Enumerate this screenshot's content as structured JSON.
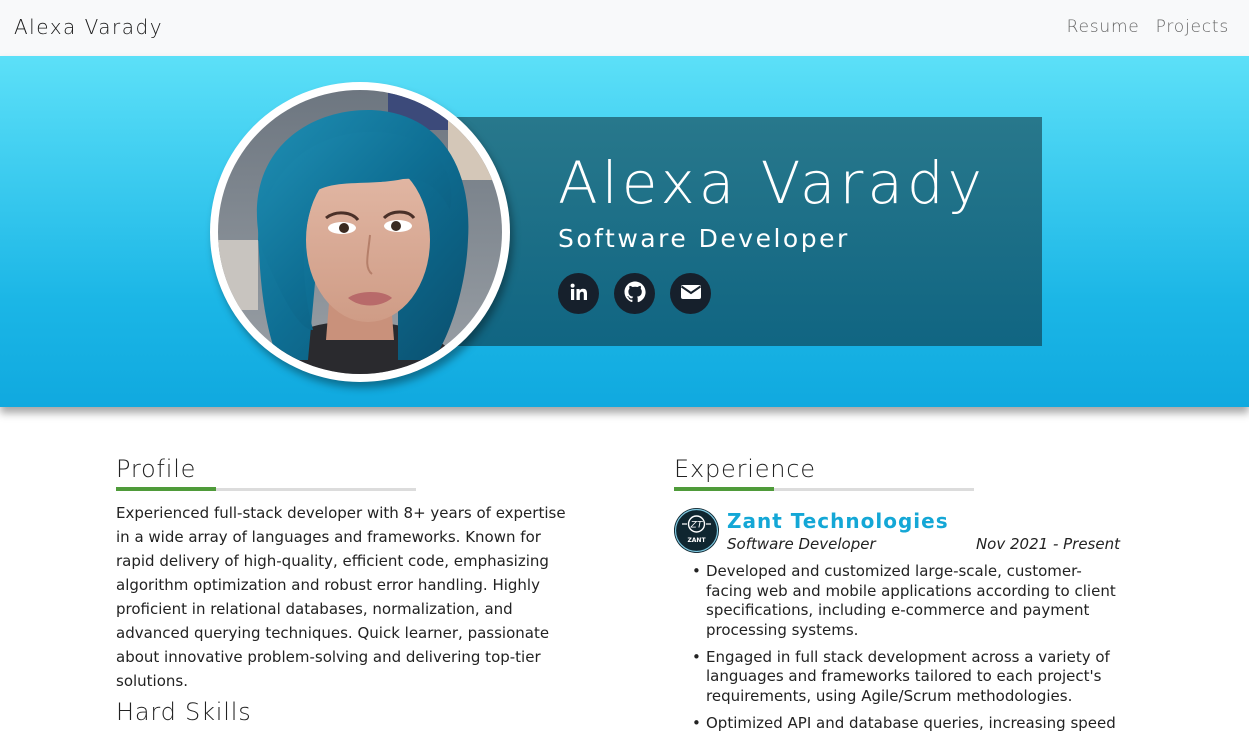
{
  "nav": {
    "brand": "Alexa Varady",
    "links": [
      "Resume",
      "Projects"
    ]
  },
  "hero": {
    "name": "Alexa Varady",
    "title": "Software Developer",
    "socials": [
      {
        "icon": "linkedin-icon"
      },
      {
        "icon": "github-icon"
      },
      {
        "icon": "envelope-icon"
      }
    ]
  },
  "profile": {
    "heading": "Profile",
    "text": "Experienced full-stack developer with 8+ years of expertise in a wide array of languages and frameworks. Known for rapid delivery of high-quality, efficient code, emphasizing algorithm optimization and robust error handling. Highly proficient in relational databases, normalization, and advanced querying techniques. Quick learner, passionate about innovative problem-solving and delivering top-tier solutions."
  },
  "skills": {
    "heading": "Hard Skills"
  },
  "experience": {
    "heading": "Experience",
    "jobs": [
      {
        "company": "Zant Technologies",
        "logo_text": "ZANT",
        "role": "Software Developer",
        "dates": "Nov 2021 - Present",
        "bullets": [
          "Developed and customized large-scale, customer-facing web and mobile applications according to client specifications, including e-commerce and payment processing systems.",
          "Engaged in full stack development across a variety of languages and frameworks tailored to each project's requirements, using Agile/Scrum methodologies.",
          "Optimized API and database queries, increasing speed and"
        ]
      }
    ]
  },
  "colors": {
    "accent_green": "#4f9b3a",
    "company_blue": "#14a7d6",
    "hero_top": "#5ce0f8",
    "hero_bottom": "#10a9df"
  }
}
